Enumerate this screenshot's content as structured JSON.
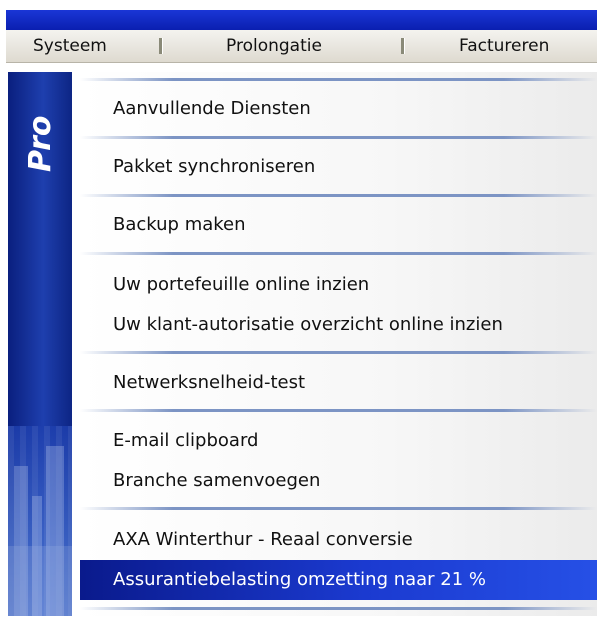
{
  "menubar": {
    "items": [
      "Systeem",
      "Prolongatie",
      "Factureren"
    ]
  },
  "sidebar": {
    "logo_text": "Pro"
  },
  "menu": {
    "items": [
      "Aanvullende Diensten",
      "Pakket synchroniseren",
      "Backup maken",
      "Uw portefeuille online inzien",
      "Uw klant-autorisatie overzicht online inzien",
      "Netwerksnelheid-test",
      "E-mail clipboard",
      "Branche samenvoegen",
      "AXA Winterthur - Reaal conversie",
      "Assurantiebelasting omzetting naar 21 %"
    ],
    "selected_index": 9
  },
  "colors": {
    "titlebar": "#0a1fb0",
    "sidebar": "#1e3fae",
    "selection": "#1b3ad0",
    "divider": "#7c94c4"
  }
}
